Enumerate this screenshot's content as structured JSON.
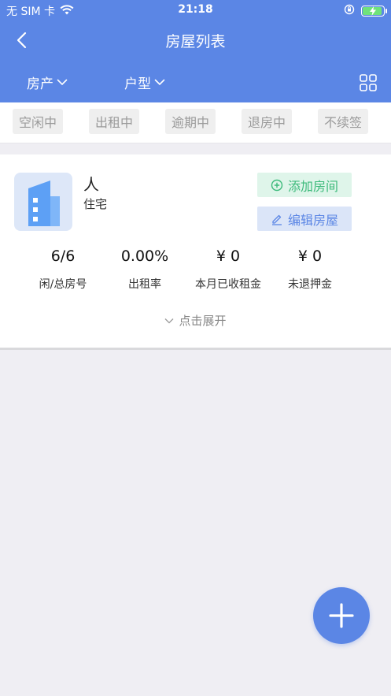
{
  "status_bar": {
    "carrier": "无 SIM 卡",
    "time": "21:18"
  },
  "nav": {
    "title": "房屋列表"
  },
  "filters": [
    {
      "label": "房产"
    },
    {
      "label": "户型"
    }
  ],
  "status_tabs": [
    "空闲中",
    "出租中",
    "逾期中",
    "退房中",
    "不续签"
  ],
  "house": {
    "name": "人",
    "type": "住宅",
    "add_room_label": "添加房间",
    "edit_house_label": "编辑房屋",
    "stats": [
      {
        "value": "6/6",
        "label": "闲/总房号"
      },
      {
        "value": "0.00%",
        "label": "出租率"
      },
      {
        "value": "¥ 0",
        "label": "本月已收租金"
      },
      {
        "value": "¥ 0",
        "label": "未退押金"
      }
    ],
    "expand_label": "点击展开"
  },
  "colors": {
    "primary": "#5b86e5",
    "background": "#efeef3",
    "add_green": "#3cba7b",
    "battery_green": "#6fe27a"
  },
  "icons": {
    "back": "chevron-left-icon",
    "grid": "grid-icon",
    "add_circle": "plus-circle-icon",
    "edit": "pencil-icon",
    "building": "building-icon",
    "fab": "plus-icon"
  }
}
